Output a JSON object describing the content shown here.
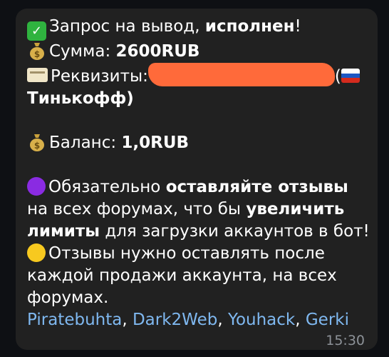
{
  "message": {
    "line1_pre": "Запрос на вывод, ",
    "line1_bold": "исполнен",
    "line1_post": "!",
    "line2_pre": "Сумма: ",
    "line2_bold": "2600RUB",
    "line3_pre": "Реквизиты:",
    "line3_open": "(",
    "line4_bold": "Тинькофф)",
    "line5_pre": "Баланс: ",
    "line5_bold": "1,0RUB",
    "p1_a": "Обязательно ",
    "p1_b": "оставляйте отзывы",
    "p1_c": "на всех форумах, что бы ",
    "p1_d": "увеличить",
    "p1_e": "лимиты",
    "p1_f": " для загрузки аккаунтов в бот!",
    "p2_a": "Отзывы нужно оставлять после",
    "p2_b": "каждой продажи аккаунта, на всех",
    "p2_c": "форумах.",
    "links": [
      "Piratebuhta",
      "Dark2Web",
      "Youhack",
      "Gerki"
    ],
    "link_separator": ", ",
    "time": "15:30"
  },
  "icons": {
    "check": "check-mark-button-icon",
    "money": "money-bag-icon",
    "card": "credit-card-icon",
    "flag": "russia-flag-icon",
    "purple": "purple-circle-icon",
    "yellow": "yellow-circle-icon"
  },
  "colors": {
    "bubble": "#212121",
    "link": "#7fb8f0",
    "redaction": "#ff6a3a",
    "timestamp": "#8d9298"
  }
}
